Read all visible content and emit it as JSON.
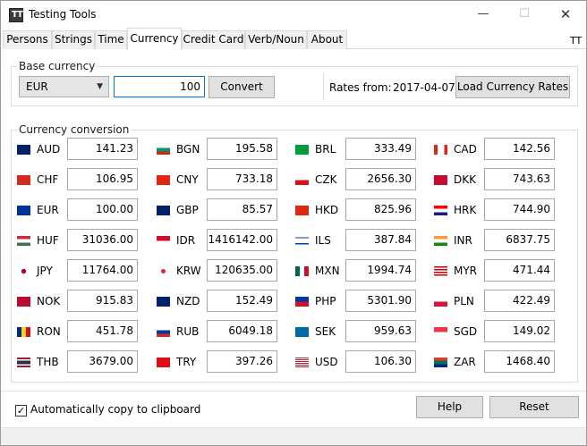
{
  "window": {
    "title": "Testing Tools",
    "icon_text": "TT"
  },
  "tabs": [
    {
      "label": "Persons"
    },
    {
      "label": "Strings"
    },
    {
      "label": "Time"
    },
    {
      "label": "Currency"
    },
    {
      "label": "Credit Card"
    },
    {
      "label": "Verb/Noun"
    },
    {
      "label": "About"
    }
  ],
  "tab_right_label": "TT",
  "base_currency": {
    "legend": "Base currency",
    "selected": "EUR",
    "amount": "100",
    "convert_label": "Convert",
    "rates_from_label": "Rates from:",
    "rates_date": "2017-04-07",
    "load_label": "Load Currency Rates"
  },
  "conversion": {
    "legend": "Currency conversion",
    "rows": [
      [
        {
          "code": "AUD",
          "value": "141.23",
          "flag": "au"
        },
        {
          "code": "BGN",
          "value": "195.58",
          "flag": "bg"
        },
        {
          "code": "BRL",
          "value": "333.49",
          "flag": "br"
        },
        {
          "code": "CAD",
          "value": "142.56",
          "flag": "ca"
        }
      ],
      [
        {
          "code": "CHF",
          "value": "106.95",
          "flag": "ch"
        },
        {
          "code": "CNY",
          "value": "733.18",
          "flag": "cn"
        },
        {
          "code": "CZK",
          "value": "2656.30",
          "flag": "cz"
        },
        {
          "code": "DKK",
          "value": "743.63",
          "flag": "dk"
        }
      ],
      [
        {
          "code": "EUR",
          "value": "100.00",
          "flag": "eu"
        },
        {
          "code": "GBP",
          "value": "85.57",
          "flag": "gb"
        },
        {
          "code": "HKD",
          "value": "825.96",
          "flag": "hk"
        },
        {
          "code": "HRK",
          "value": "744.90",
          "flag": "hr"
        }
      ],
      [
        {
          "code": "HUF",
          "value": "31036.00",
          "flag": "hu"
        },
        {
          "code": "IDR",
          "value": "1416142.00",
          "flag": "id"
        },
        {
          "code": "ILS",
          "value": "387.84",
          "flag": "il"
        },
        {
          "code": "INR",
          "value": "6837.75",
          "flag": "in"
        }
      ],
      [
        {
          "code": "JPY",
          "value": "11764.00",
          "flag": "jp"
        },
        {
          "code": "KRW",
          "value": "120635.00",
          "flag": "kr"
        },
        {
          "code": "MXN",
          "value": "1994.74",
          "flag": "mx"
        },
        {
          "code": "MYR",
          "value": "471.44",
          "flag": "my"
        }
      ],
      [
        {
          "code": "NOK",
          "value": "915.83",
          "flag": "no"
        },
        {
          "code": "NZD",
          "value": "152.49",
          "flag": "nz"
        },
        {
          "code": "PHP",
          "value": "5301.90",
          "flag": "ph"
        },
        {
          "code": "PLN",
          "value": "422.49",
          "flag": "pl"
        }
      ],
      [
        {
          "code": "RON",
          "value": "451.78",
          "flag": "ro"
        },
        {
          "code": "RUB",
          "value": "6049.18",
          "flag": "ru"
        },
        {
          "code": "SEK",
          "value": "959.63",
          "flag": "se"
        },
        {
          "code": "SGD",
          "value": "149.02",
          "flag": "sg"
        }
      ],
      [
        {
          "code": "THB",
          "value": "3679.00",
          "flag": "th"
        },
        {
          "code": "TRY",
          "value": "397.26",
          "flag": "tr"
        },
        {
          "code": "USD",
          "value": "106.30",
          "flag": "us"
        },
        {
          "code": "ZAR",
          "value": "1468.40",
          "flag": "za"
        }
      ]
    ]
  },
  "footer": {
    "auto_copy_label": "Automatically copy to clipboard",
    "auto_copy_checked": true,
    "help_label": "Help",
    "reset_label": "Reset"
  },
  "colors": {
    "focus_border": "#0078d7",
    "button_bg": "#e1e1e1"
  }
}
